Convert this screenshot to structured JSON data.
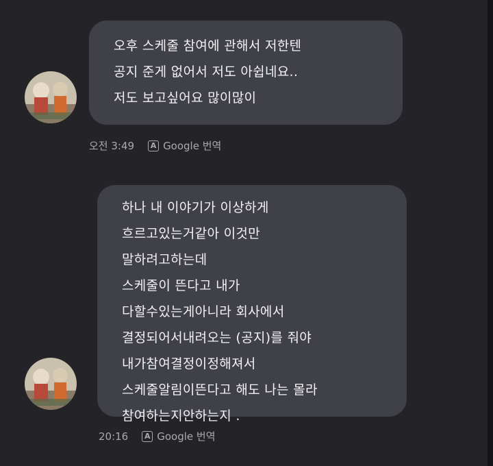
{
  "messages": [
    {
      "lines": [
        "오후 스케줄 참여에 관해서 저한텐",
        "공지 준게 없어서 저도 아쉽네요..",
        "저도 보고싶어요 많이많이"
      ],
      "time": "오전 3:49",
      "translate_label": "Google 번역",
      "translate_icon": "A"
    },
    {
      "lines": [
        "하나 내 이야기가 이상하게",
        "흐르고있는거같아 이것만",
        "말하려고하는데",
        "스케줄이 뜬다고 내가",
        "다할수있는게아니라 회사에서",
        "결정되어서내려오는 (공지)를 줘야",
        "내가참여결정이정해져서",
        "스케줄알림이뜬다고 해도 나는 몰라",
        "참여하는지안하는지 ."
      ],
      "time": "20:16",
      "translate_label": "Google 번역",
      "translate_icon": "A"
    }
  ],
  "colors": {
    "background": "#242428",
    "bubble": "#3f4048",
    "text": "#f2f2f4",
    "meta": "#a9a9b1"
  }
}
